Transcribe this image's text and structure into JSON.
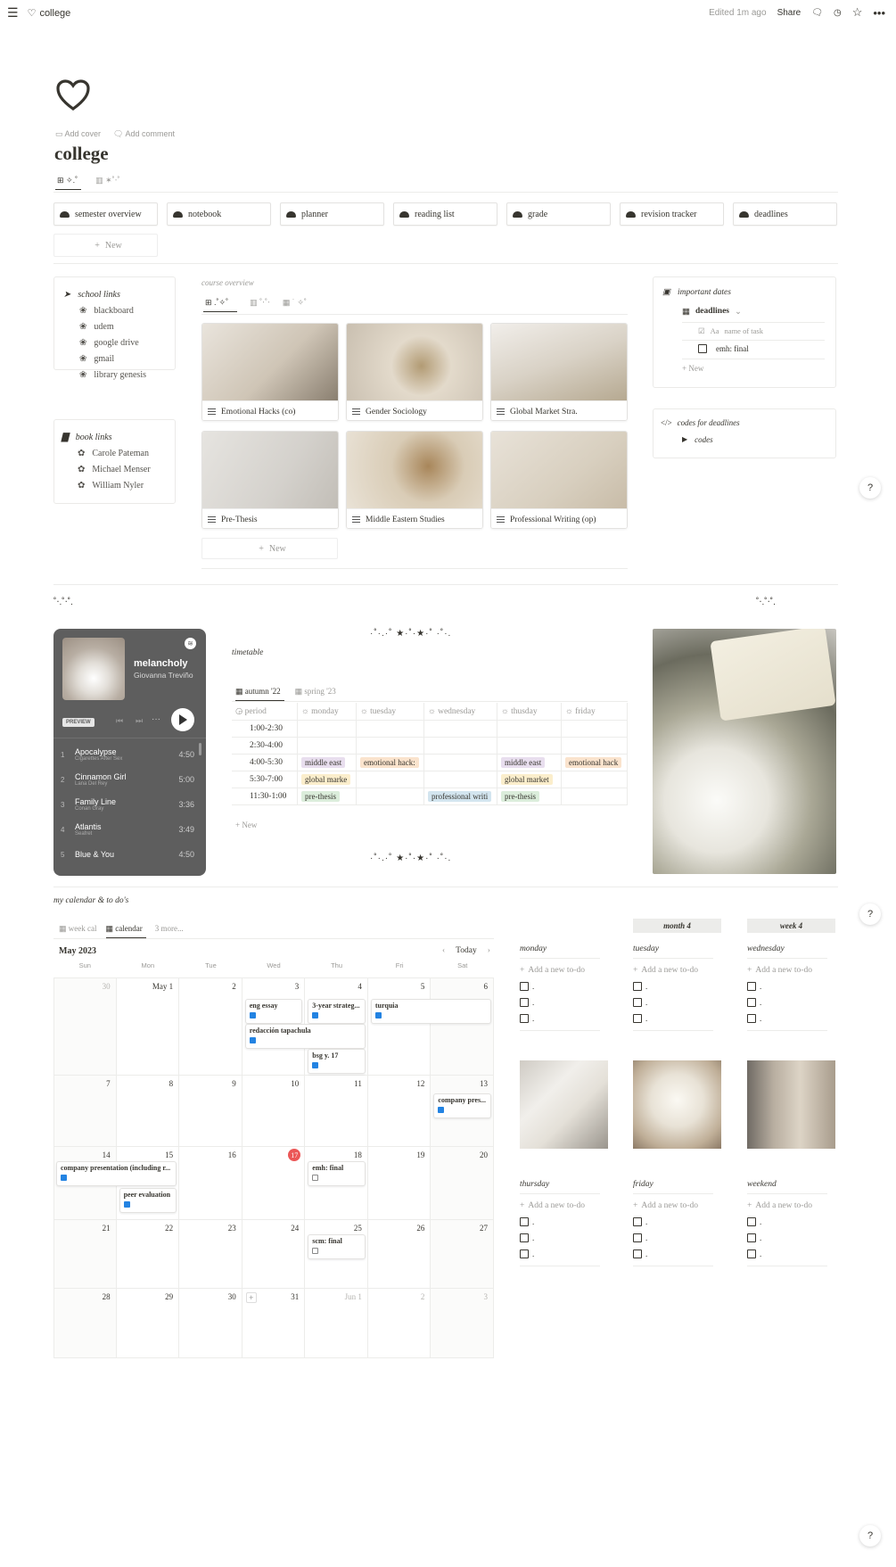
{
  "topbar": {
    "title": "college",
    "edited": "Edited 1m ago",
    "share": "Share"
  },
  "page": {
    "add_cover": "Add cover",
    "add_comment": "Add comment",
    "title": "college",
    "view_tab_1": "✧.˚",
    "view_tab_2": "✶˚‧˚"
  },
  "nav_chips": [
    "semester overview",
    "notebook",
    "planner",
    "reading list",
    "grade",
    "revision tracker",
    "deadlines"
  ],
  "new_label": "New",
  "school_links": {
    "title": "school links",
    "items": [
      "blackboard",
      "udem",
      "google drive",
      "gmail",
      "library genesis"
    ]
  },
  "book_links": {
    "title": "book links",
    "items": [
      "Carole Pateman",
      "Michael Menser",
      "William Nyler"
    ]
  },
  "course_overview": {
    "title": "course overview",
    "tabs": [
      ".˚✧˚",
      "˚‧˚‧",
      "˙ ✧˚"
    ],
    "cards": [
      "Emotional Hacks (co)",
      "Gender Sociology",
      "Global Market Stra.",
      "Pre-Thesis",
      "Middle Eastern Studies",
      "Professional Writing (op)"
    ],
    "card_colors": [
      "#d9d4cc",
      "#cfc6b8",
      "#d6d1ca",
      "#dcdad5",
      "#cdc3b3",
      "#ddd8cf"
    ]
  },
  "important_dates": {
    "title": "important dates",
    "db": "deadlines",
    "col": "name of task",
    "row": "emh: final"
  },
  "codes": {
    "title": "codes for deadlines",
    "toggle": "codes"
  },
  "deco": {
    "left": "˚‧.˚‧˚.",
    "right": "˚‧.˚‧˚.",
    "stars": "·˚·.·˚ ★·˚·★·˚ ·˚·."
  },
  "player": {
    "title": "melancholy",
    "artist": "Giovanna Treviño",
    "preview": "PREVIEW",
    "tracks": [
      {
        "n": "1",
        "name": "Apocalypse",
        "artist": "Cigarettes After Sex",
        "dur": "4:50"
      },
      {
        "n": "2",
        "name": "Cinnamon Girl",
        "artist": "Lana Del Rey",
        "dur": "5:00"
      },
      {
        "n": "3",
        "name": "Family Line",
        "artist": "Conan Gray",
        "dur": "3:36"
      },
      {
        "n": "4",
        "name": "Atlantis",
        "artist": "Seafret",
        "dur": "3:49"
      },
      {
        "n": "5",
        "name": "Blue & You",
        "artist": "",
        "dur": "4:50"
      }
    ]
  },
  "timetable": {
    "title": "timetable",
    "tabs": [
      "autumn '22",
      "spring '23"
    ],
    "headers": [
      "period",
      "monday",
      "tuesday",
      "wednesday",
      "thusday",
      "friday"
    ],
    "rows": [
      [
        "1:00-2:30",
        "",
        "",
        "",
        "",
        ""
      ],
      [
        "2:30-4:00",
        "",
        "",
        "",
        "",
        ""
      ],
      [
        "4:00-5:30",
        "middle east",
        "emotional hack:",
        "",
        "middle east",
        "emotional hack"
      ],
      [
        "5:30-7:00",
        "global marke",
        "",
        "",
        "global market",
        ""
      ],
      [
        "11:30-1:00",
        "pre-thesis",
        "",
        "professional writi",
        "pre-thesis",
        ""
      ]
    ],
    "tag_colors": {
      "middle east": "#e8deee",
      "emotional hack:": "#fae3cd",
      "emotional hack": "#fae3cd",
      "global marke": "#fbeecc",
      "global market": "#fbeecc",
      "pre-thesis": "#dbeddb",
      "professional writi": "#d3e5ef"
    },
    "new": "New"
  },
  "calendar": {
    "section_title": "my calendar & to do's",
    "tabs": [
      "week cal",
      "calendar",
      "3 more..."
    ],
    "month": "May 2023",
    "today": "Today",
    "weekdays": [
      "Sun",
      "Mon",
      "Tue",
      "Wed",
      "Thu",
      "Fri",
      "Sat"
    ],
    "weeks": [
      [
        "30",
        "May 1",
        "2",
        "3",
        "4",
        "5",
        "6"
      ],
      [
        "7",
        "8",
        "9",
        "10",
        "11",
        "12",
        "13"
      ],
      [
        "14",
        "15",
        "16",
        "17",
        "18",
        "19",
        "20"
      ],
      [
        "21",
        "22",
        "23",
        "24",
        "25",
        "26",
        "27"
      ],
      [
        "28",
        "29",
        "30",
        "31",
        "Jun 1",
        "2",
        "3"
      ]
    ],
    "events": [
      {
        "label": "eng essay",
        "done": true
      },
      {
        "label": "3-year strateg...",
        "done": true
      },
      {
        "label": "turquia",
        "done": true
      },
      {
        "label": "redacción tapachula",
        "done": true
      },
      {
        "label": "bsg y. 17",
        "done": true
      },
      {
        "label": "company pres...",
        "done": true
      },
      {
        "label": "company presentation (including r...",
        "done": true
      },
      {
        "label": "emh: final",
        "done": false
      },
      {
        "label": "peer evaluation",
        "done": true
      },
      {
        "label": "scm: final",
        "done": false
      }
    ]
  },
  "todos": {
    "month_label": "month 4",
    "week_label": "week 4",
    "add": "Add a new to-do",
    "days_top": [
      "monday",
      "tuesday",
      "wednesday"
    ],
    "days_bottom": [
      "thursday",
      "friday",
      "weekend"
    ],
    "item": "."
  }
}
